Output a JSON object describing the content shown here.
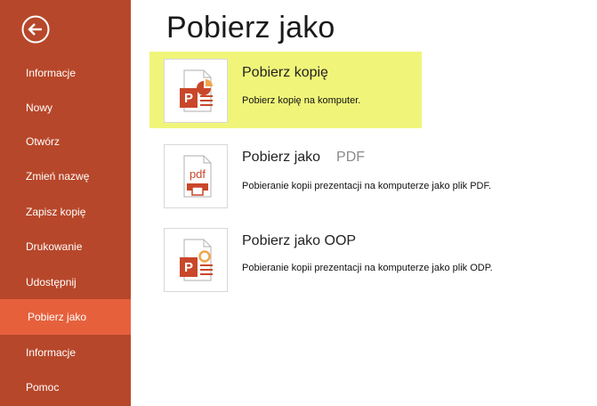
{
  "sidebar": {
    "back_label": "Wstecz",
    "items": [
      {
        "label": "Informacje"
      },
      {
        "label": "Nowy"
      },
      {
        "label": "Otwórz"
      },
      {
        "label": "Zmień nazwę"
      },
      {
        "label": "Zapisz kopię"
      },
      {
        "label": "Drukowanie"
      },
      {
        "label": "Udostępnij"
      },
      {
        "label": "Pobierz jako",
        "active": true
      },
      {
        "label": "Informacje"
      },
      {
        "label": "Pomoc"
      }
    ]
  },
  "main": {
    "title": "Pobierz jako",
    "options": [
      {
        "title": "Pobierz kopię",
        "description": "Pobierz kopię na komputer.",
        "icon": "powerpoint-file-icon",
        "highlighted": true
      },
      {
        "title": "Pobierz jako",
        "title_suffix": "PDF",
        "description": "Pobieranie kopii prezentacji na komputerze jako plik PDF.",
        "icon": "pdf-file-icon"
      },
      {
        "title": "Pobierz jako OOP",
        "description": "Pobieranie kopii prezentacji na komputerze jako plik ODP.",
        "icon": "odp-file-icon"
      }
    ]
  },
  "colors": {
    "sidebar": "#b7472a",
    "sidebar_active": "#e6603c",
    "highlight": "#f0f57a",
    "icon_accent": "#c9472a"
  }
}
